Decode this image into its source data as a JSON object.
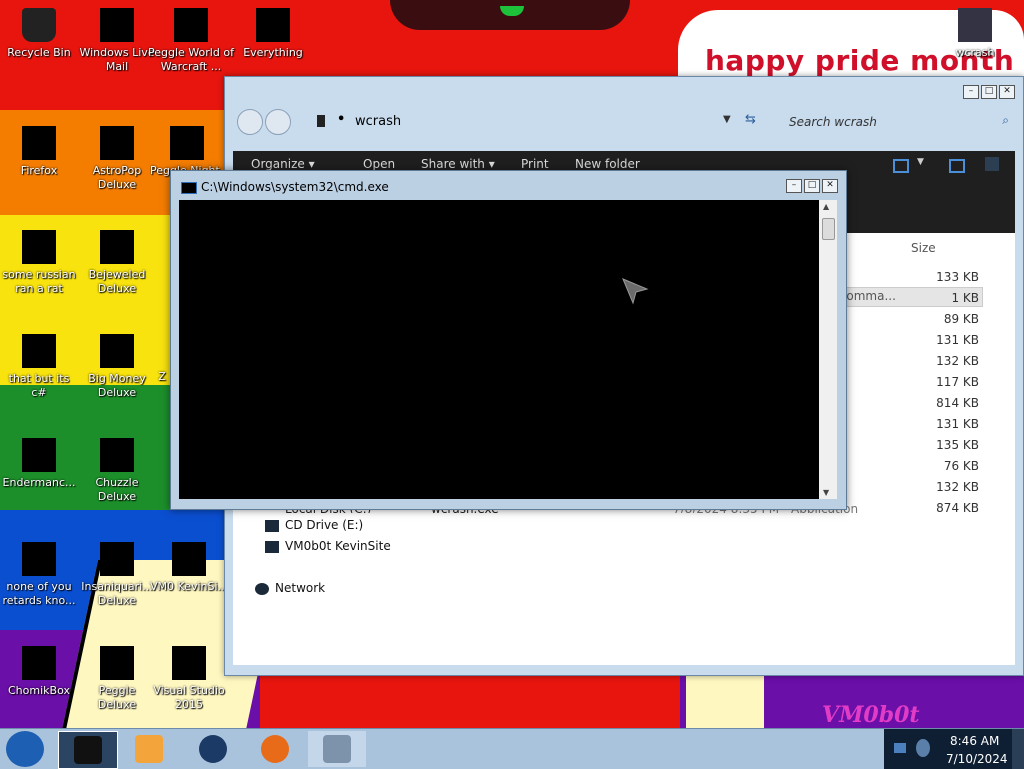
{
  "wallpaper": {
    "banner_text": "happy pride month",
    "corner_text": "VM0b0t",
    "stripes": [
      "#e8150f",
      "#f47d00",
      "#f8e30f",
      "#1c8f2a",
      "#0b4fd1",
      "#6a0fa8"
    ]
  },
  "desktop_icons": [
    {
      "label": "Recycle Bin"
    },
    {
      "label": "Windows Live Mail"
    },
    {
      "label": "Peggle World of Warcraft ..."
    },
    {
      "label": "Everything"
    },
    {
      "label": "wcrash"
    },
    {
      "label": "Firefox"
    },
    {
      "label": "AstroPop Deluxe"
    },
    {
      "label": "Peggle Night..."
    },
    {
      "label": "some russian ran a rat"
    },
    {
      "label": "Bejeweled Deluxe"
    },
    {
      "label": "that but its c#"
    },
    {
      "label": "Big Money Deluxe"
    },
    {
      "label": "Z"
    },
    {
      "label": "Endermanc..."
    },
    {
      "label": "Chuzzle Deluxe"
    },
    {
      "label": "none of you retards kno..."
    },
    {
      "label": "Insaniquari... Deluxe"
    },
    {
      "label": "VM0 KevinSi..."
    },
    {
      "label": "ChomikBox"
    },
    {
      "label": "Peggle Deluxe"
    },
    {
      "label": "Visual Studio 2015"
    }
  ],
  "explorer": {
    "address": "wcrash",
    "search_placeholder": "Search wcrash",
    "toolbar": [
      "Organize ▾",
      "Open",
      "Share with ▾",
      "Print",
      "New folder"
    ],
    "size_header": "Size",
    "selected_partial": "Comma...",
    "sizes": [
      "133 KB",
      "1 KB",
      "89 KB",
      "131 KB",
      "132 KB",
      "117 KB",
      "814 KB",
      "131 KB",
      "135 KB",
      "76 KB",
      "132 KB",
      "874 KB"
    ],
    "partial_row": {
      "name": "wcrash.exe",
      "date": "7/8/2024 8:35 PM",
      "type": "Application",
      "drive": "Local Disk (C:)"
    },
    "nav_items": [
      "CD Drive (E:)",
      "VM0b0t KevinSite",
      "Network"
    ]
  },
  "cmd": {
    "title": "C:\\Windows\\system32\\cmd.exe"
  },
  "taskbar": {
    "time": "8:46 AM",
    "date": "7/10/2024"
  },
  "caption": {
    "min": "–",
    "max": "□",
    "close": "✕"
  }
}
